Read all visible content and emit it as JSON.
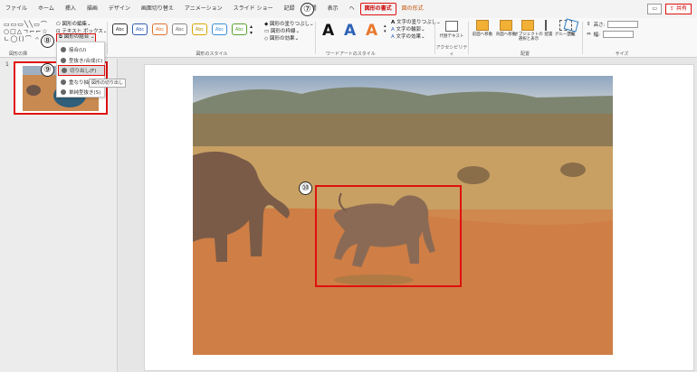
{
  "menu": {
    "tabs": [
      "ファイル",
      "ホーム",
      "挿入",
      "描画",
      "デザイン",
      "画面切り替え",
      "アニメーション",
      "スライド ショー",
      "記録",
      "校閲",
      "表示",
      "ヘ"
    ],
    "active_tab": "図形の書式",
    "context_tab": "図の形式",
    "share_label": "共有"
  },
  "ribbon": {
    "shape_edit": "図形の編集",
    "text_box": "テキスト ボックス",
    "combine_label": "図形の結合",
    "insert_group": "図形の挿",
    "style_samples": [
      "Abc",
      "Abc",
      "Abc",
      "Abc",
      "Abc",
      "Abc",
      "Abc"
    ],
    "fill": "図形の塗りつぶし",
    "outline": "図形の枠線",
    "effect": "図形の効果",
    "shape_styles_group": "図形のスタイル",
    "wordart_group": "ワードアートのスタイル",
    "text_fill": "文字の塗りつぶし",
    "text_outline": "文字の輪郭",
    "text_effect": "文字の効果",
    "accessibility_group": "アクセシビリティ",
    "alt_text": "代替テキスト",
    "bring_forward": "前面へ移動",
    "send_backward": "背面へ移動",
    "selection_pane": "オブジェクトの選択と表示",
    "align": "配置",
    "group": "グループ化",
    "rotate": "回転",
    "arrange_group": "配置",
    "height_label": "高さ:",
    "width_label": "幅:",
    "size_group": "サイズ"
  },
  "dropdown": {
    "items": [
      "接合(U)",
      "型抜き/合成(C)",
      "切り出し(F)",
      "重なり抽出(I)",
      "単純型抜き(S)"
    ],
    "tooltip": "図形の切り出し"
  },
  "callouts": [
    "⑦",
    "⑧",
    "⑨",
    "⑩"
  ],
  "slides": {
    "number": "1"
  },
  "colors": {
    "accent": "#e01010",
    "sand": "#d48a52",
    "sky": "#aab8c8"
  },
  "icons": [
    "shapes-icon",
    "abc-style-icon",
    "wordart-a-icon",
    "alt-text-icon",
    "bring-forward-icon",
    "send-backward-icon",
    "align-icon",
    "group-icon",
    "rotate-icon",
    "height-icon",
    "width-icon"
  ]
}
